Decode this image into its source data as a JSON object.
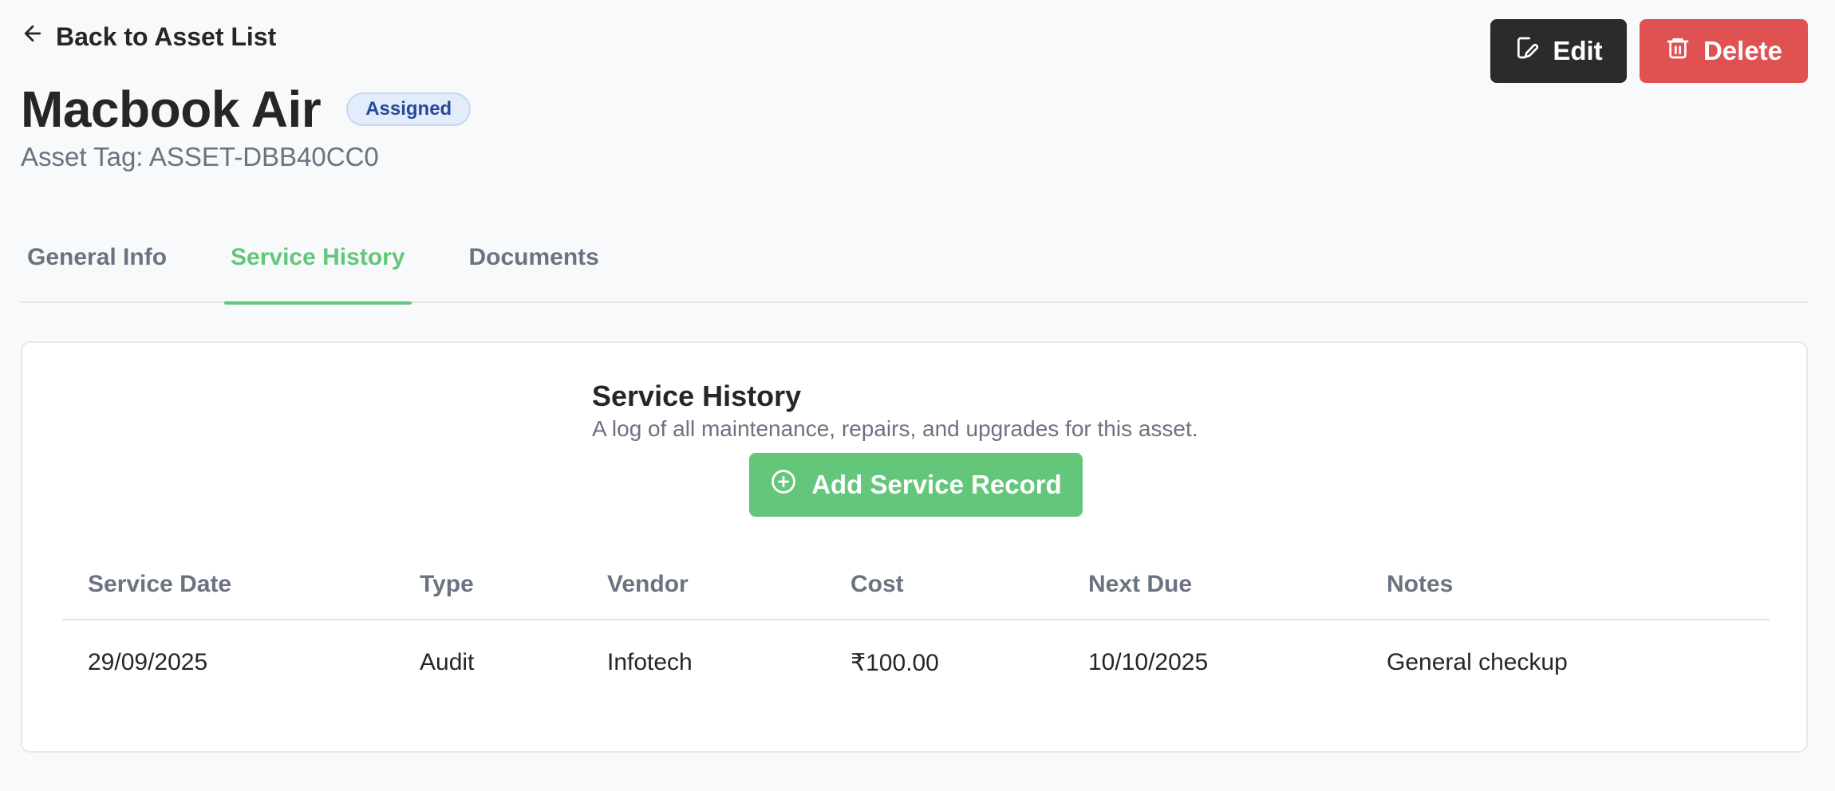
{
  "nav": {
    "back_label": "Back to Asset List"
  },
  "actions": {
    "edit_label": "Edit",
    "delete_label": "Delete"
  },
  "asset": {
    "name": "Macbook Air",
    "status": "Assigned",
    "tag_label": "Asset Tag:",
    "tag_value": "ASSET-DBB40CC0"
  },
  "tabs": [
    {
      "label": "General Info",
      "active": false
    },
    {
      "label": "Service History",
      "active": true
    },
    {
      "label": "Documents",
      "active": false
    }
  ],
  "service_history": {
    "title": "Service History",
    "description": "A log of all maintenance, repairs, and upgrades for this asset.",
    "add_button_label": "Add Service Record",
    "columns": [
      "Service Date",
      "Type",
      "Vendor",
      "Cost",
      "Next Due",
      "Notes"
    ],
    "rows": [
      [
        "29/09/2025",
        "Audit",
        "Infotech",
        "₹100.00",
        "10/10/2025",
        "General checkup"
      ]
    ]
  },
  "colors": {
    "accent_green": "#63c67a",
    "delete_red": "#e05251",
    "edit_dark": "#2b2b2b",
    "badge_blue": "#264a96"
  },
  "icons": {
    "back": "arrow-left-icon",
    "edit": "edit-icon",
    "delete": "trash-icon",
    "add": "plus-circle-icon"
  }
}
